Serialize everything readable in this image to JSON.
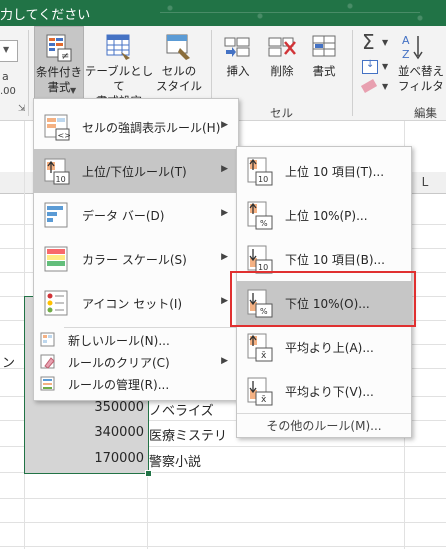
{
  "title_bar": {
    "text": "力してください"
  },
  "ribbon": {
    "buttons": {
      "conditional_format": "条件付き\n書式",
      "table_format": "テーブルとして\n書式設定",
      "cell_style": "セルの\nスタイル",
      "insert": "挿入",
      "delete": "削除",
      "format": "書式",
      "sort_filter": "並べ替え\nフィルタ"
    },
    "groups": {
      "cells": "セル",
      "edit": "編集"
    },
    "fragments": {
      "left_a": "a",
      "left_b": ".00"
    }
  },
  "sheet": {
    "column_headers": [
      "L"
    ],
    "rows": [
      {
        "value": "350000",
        "text": "ノベライズ"
      },
      {
        "value": "340000",
        "text": "医療ミステリ"
      },
      {
        "value": "170000",
        "text": "警察小説"
      }
    ],
    "left_fragment": "ン"
  },
  "menu": {
    "items": [
      {
        "label": "セルの強調表示ルール(H)",
        "icon": "highlight-rules-icon"
      },
      {
        "label": "上位/下位ルール(T)",
        "icon": "top-bottom-rules-icon"
      },
      {
        "label": "データ バー(D)",
        "icon": "data-bars-icon"
      },
      {
        "label": "カラー スケール(S)",
        "icon": "color-scales-icon"
      },
      {
        "label": "アイコン セット(I)",
        "icon": "icon-sets-icon"
      }
    ],
    "small_items": [
      {
        "label": "新しいルール(N)...",
        "icon": "new-rule-icon"
      },
      {
        "label": "ルールのクリア(C)",
        "icon": "clear-rules-icon"
      },
      {
        "label": "ルールの管理(R)...",
        "icon": "manage-rules-icon"
      }
    ]
  },
  "submenu": {
    "items": [
      {
        "label": "上位 10 項目(T)...",
        "badge": "10",
        "icon": "top-10-items-icon"
      },
      {
        "label": "上位 10%(P)...",
        "badge": "%",
        "icon": "top-10-percent-icon"
      },
      {
        "label": "下位 10 項目(B)...",
        "badge": "10",
        "icon": "bottom-10-items-icon"
      },
      {
        "label": "下位 10%(O)...",
        "badge": "%",
        "icon": "bottom-10-percent-icon"
      },
      {
        "label": "平均より上(A)...",
        "badge": "x̄",
        "icon": "above-average-icon"
      },
      {
        "label": "平均より下(V)...",
        "badge": "x̄",
        "icon": "below-average-icon"
      }
    ],
    "more": "その他のルール(M)..."
  },
  "colors": {
    "excel_green": "#217346",
    "highlight": "#c6c6c6",
    "red_outline": "#e03030"
  }
}
